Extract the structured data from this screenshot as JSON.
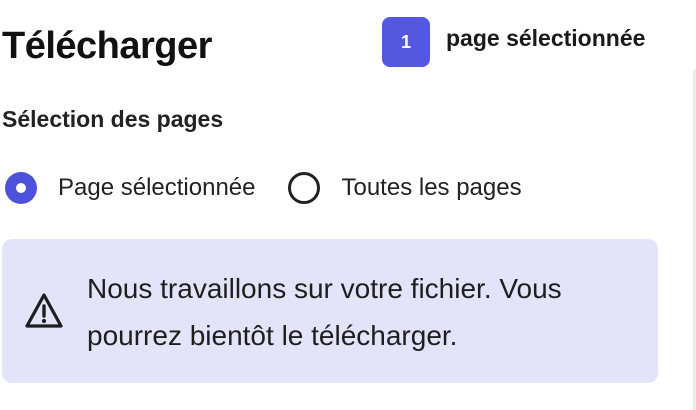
{
  "header": {
    "title": "Télécharger",
    "selected_count": "1",
    "selected_label": "page sélectionnée"
  },
  "page_selection": {
    "heading": "Sélection des pages",
    "options": [
      {
        "label": "Page sélectionnée",
        "checked": true
      },
      {
        "label": "Toutes les pages",
        "checked": false
      }
    ]
  },
  "alert": {
    "icon": "warning-icon",
    "message": "Nous travaillons sur votre fichier. Vous pourrez bientôt le télécharger."
  },
  "colors": {
    "accent": "#5458e0",
    "alert_background": "#e3e4fa"
  }
}
